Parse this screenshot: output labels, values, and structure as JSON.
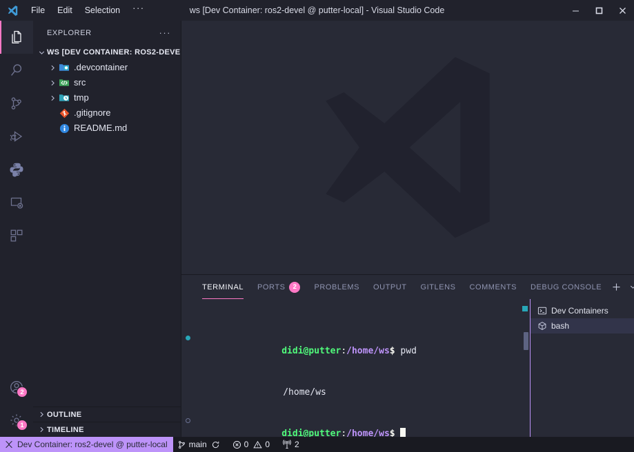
{
  "titlebar": {
    "logo_icon": "vscode-logo-icon",
    "title": "ws [Dev Container: ros2-devel @ putter-local] - Visual Studio Code",
    "menus": [
      {
        "label": "File",
        "name": "menu-file"
      },
      {
        "label": "Edit",
        "name": "menu-edit"
      },
      {
        "label": "Selection",
        "name": "menu-selection"
      },
      {
        "label": "···",
        "name": "menu-more"
      }
    ],
    "window_controls": [
      {
        "name": "minimize-button",
        "icon": "minimize-icon"
      },
      {
        "name": "maximize-button",
        "icon": "maximize-icon"
      },
      {
        "name": "close-button",
        "icon": "close-icon"
      }
    ]
  },
  "activitybar": {
    "items": [
      {
        "name": "activity-explorer",
        "icon": "files-icon",
        "active": true
      },
      {
        "name": "activity-search",
        "icon": "search-icon",
        "active": false
      },
      {
        "name": "activity-source-control",
        "icon": "source-control-icon",
        "active": false
      },
      {
        "name": "activity-run-debug",
        "icon": "run-debug-icon",
        "active": false
      },
      {
        "name": "activity-python",
        "icon": "python-icon",
        "active": false
      },
      {
        "name": "activity-remote-explorer",
        "icon": "remote-explorer-icon",
        "active": false
      },
      {
        "name": "activity-extensions",
        "icon": "extensions-icon",
        "active": false
      }
    ],
    "bottom": [
      {
        "name": "activity-accounts",
        "icon": "account-icon",
        "badge": "2"
      },
      {
        "name": "activity-settings",
        "icon": "gear-icon",
        "badge": "1"
      }
    ]
  },
  "sidebar": {
    "header": "EXPLORER",
    "header_more": "···",
    "root_label": "WS [DEV CONTAINER: ROS2-DEVE...",
    "tree": [
      {
        "label": ".devcontainer",
        "icon": "folder-devcontainer-icon",
        "expandable": true
      },
      {
        "label": "src",
        "icon": "folder-src-icon",
        "expandable": true
      },
      {
        "label": "tmp",
        "icon": "folder-tmp-icon",
        "expandable": true
      },
      {
        "label": ".gitignore",
        "icon": "git-file-icon",
        "expandable": false
      },
      {
        "label": "README.md",
        "icon": "info-file-icon",
        "expandable": false
      }
    ],
    "sections": [
      {
        "label": "OUTLINE",
        "name": "sidebar-section-outline"
      },
      {
        "label": "TIMELINE",
        "name": "sidebar-section-timeline"
      }
    ]
  },
  "editor": {
    "watermark_icon": "vscode-watermark-logo"
  },
  "panel": {
    "tabs": [
      {
        "label": "TERMINAL",
        "name": "tab-terminal",
        "active": true,
        "badge": null
      },
      {
        "label": "PORTS",
        "name": "tab-ports",
        "active": false,
        "badge": "2"
      },
      {
        "label": "PROBLEMS",
        "name": "tab-problems",
        "active": false,
        "badge": null
      },
      {
        "label": "OUTPUT",
        "name": "tab-output",
        "active": false,
        "badge": null
      },
      {
        "label": "GITLENS",
        "name": "tab-gitlens",
        "active": false,
        "badge": null
      },
      {
        "label": "COMMENTS",
        "name": "tab-comments",
        "active": false,
        "badge": null
      },
      {
        "label": "DEBUG CONSOLE",
        "name": "tab-debug-console",
        "active": false,
        "badge": null
      }
    ],
    "actions": [
      {
        "name": "new-terminal-button",
        "icon": "plus-icon"
      },
      {
        "name": "terminal-split-dropdown-button",
        "icon": "chevron-down-icon"
      },
      {
        "name": "panel-more-actions-button",
        "icon": "ellipsis-icon"
      },
      {
        "name": "close-panel-button",
        "icon": "close-icon"
      }
    ],
    "terminal": {
      "line1": {
        "user": "didi@putter",
        "colon": ":",
        "path": "/home/ws",
        "dollar": "$",
        "command": " pwd"
      },
      "line2": {
        "output": "/home/ws"
      },
      "line3": {
        "user": "didi@putter",
        "colon": ":",
        "path": "/home/ws",
        "dollar": "$"
      }
    },
    "terminal_tabs": {
      "group_label": "Dev Containers",
      "group_icon": "terminal-icon",
      "items": [
        {
          "label": "bash",
          "icon": "container-cube-icon",
          "active": true
        }
      ]
    }
  },
  "statusbar": {
    "remote": {
      "label": "Dev Container: ros2-devel @ putter-local",
      "icon": "remote-icon"
    },
    "branch": {
      "label": "main",
      "icon": "branch-icon",
      "sync_icon": "sync-icon"
    },
    "errors": {
      "label": "0",
      "icon": "error-icon"
    },
    "warnings": {
      "label": "0",
      "icon": "warning-icon"
    },
    "radio": {
      "label": "2",
      "icon": "radio-tower-icon"
    }
  },
  "colors": {
    "accent_pink": "#ff79c6",
    "accent_purple": "#bd93f9",
    "green": "#50fa7b",
    "editor_bg": "#282a36",
    "sidebar_bg": "#21222c",
    "statusbar_bg": "#191a21"
  }
}
